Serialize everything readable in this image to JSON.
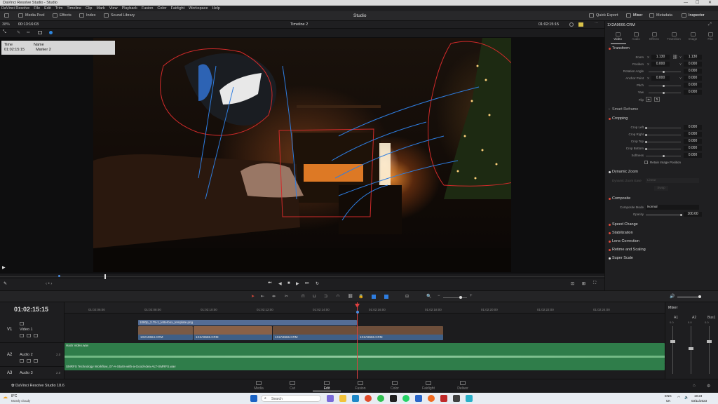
{
  "window": {
    "title": "DaVinci Resolve Studio - Studio"
  },
  "menu": [
    "DaVinci Resolve",
    "File",
    "Edit",
    "Trim",
    "Timeline",
    "Clip",
    "Mark",
    "View",
    "Playback",
    "Fusion",
    "Color",
    "Fairlight",
    "Workspace",
    "Help"
  ],
  "toolbar": {
    "media_pool": "Media Pool",
    "effects": "Effects",
    "index": "Index",
    "sound_library": "Sound Library",
    "project": "Studio",
    "quick_export": "Quick Export",
    "mixer": "Mixer",
    "metadata": "Metadata",
    "inspector": "Inspector"
  },
  "viewer": {
    "zoom": "38%",
    "timecode_left": "00:13:16:03",
    "timeline_name": "Timeline 2",
    "timecode_right": "01:02:15:15",
    "marker": {
      "time_label": "Time",
      "name_label": "Name",
      "time": "01:02:15:15",
      "name": "Marker 2"
    }
  },
  "inspector": {
    "clip_name": "1X2A9666.CRM",
    "tabs": [
      "Video",
      "Audio",
      "Effects",
      "Transition",
      "Image",
      "File"
    ],
    "transform": {
      "title": "Transform",
      "zoom_label": "Zoom",
      "zoom_x": "1.130",
      "zoom_y": "1.130",
      "position_label": "Position",
      "pos_x": "0.000",
      "pos_y": "0.000",
      "rotation_label": "Rotation Angle",
      "rotation": "0.000",
      "anchor_label": "Anchor Point",
      "anchor_x": "0.000",
      "anchor_y": "0.000",
      "pitch_label": "Pitch",
      "pitch": "0.000",
      "yaw_label": "Yaw",
      "yaw": "0.000",
      "flip_label": "Flip",
      "x_label": "X",
      "y_label": "Y"
    },
    "smart_reframe": "Smart Reframe",
    "cropping": {
      "title": "Cropping",
      "left_label": "Crop Left",
      "left": "0.000",
      "right_label": "Crop Right",
      "right": "0.000",
      "top_label": "Crop Top",
      "top": "0.000",
      "bottom_label": "Crop Bottom",
      "bottom": "0.000",
      "softness_label": "Softness",
      "softness": "0.000",
      "retain_label": "Retain Image Position"
    },
    "dynamic_zoom": {
      "title": "Dynamic Zoom",
      "ease_label": "Dynamic Zoom Ease",
      "ease_value": "Linear",
      "swap": "Swap"
    },
    "composite": {
      "title": "Composite",
      "mode_label": "Composite Mode",
      "mode": "Normal",
      "opacity_label": "Opacity",
      "opacity": "100.00"
    },
    "sections": [
      "Speed Change",
      "Stabilization",
      "Lens Correction",
      "Retime and Scaling",
      "Super Scale"
    ]
  },
  "timeline": {
    "timecode": "01:02:15:15",
    "ruler": [
      "01:02:06:00",
      "01:02:08:00",
      "01:02:10:00",
      "01:02:12:00",
      "01:02:14:00",
      "01:02:16:00",
      "01:02:18:00",
      "01:02:20:00",
      "01:02:22:00",
      "01:02:24:00"
    ],
    "tracks": {
      "v1_id": "V1",
      "v1_name": "Video 1",
      "a2_id": "A2",
      "a2_name": "Audio 2",
      "a2_ch": "2.0",
      "a3_id": "A3",
      "a3_name": "Audio 3",
      "a3_ch": "2.0"
    },
    "title_clip": "1080p_2.75-1_letterbox_template.png",
    "video_clips": [
      "1X2A9664.CRM",
      "1X2A9665.CRM",
      "1X2A9666.CRM",
      "1X2A9666.CRM"
    ],
    "audio_clip_1": "Hack Video.wav",
    "audio_clip_2": "SMRFS Technology Workflow_07-A-Starts-with-a-Good-Idea-ALT-SMRFS.wav"
  },
  "mixer": {
    "title": "Mixer",
    "ch1": "A1",
    "ch2": "A2",
    "ch3": "Bus1",
    "val1": "0.0",
    "val2": "0.0",
    "val3": "0.0"
  },
  "app_footer": {
    "brand": "DaVinci Resolve Studio 18.6"
  },
  "pages": [
    "Media",
    "Cut",
    "Edit",
    "Fusion",
    "Color",
    "Fairlight",
    "Deliver"
  ],
  "taskbar": {
    "temp": "8°C",
    "weather": "Mostly cloudy",
    "search": "Search",
    "lang1": "ENG",
    "lang2": "UK",
    "time": "19:23",
    "date": "03/11/2023"
  }
}
